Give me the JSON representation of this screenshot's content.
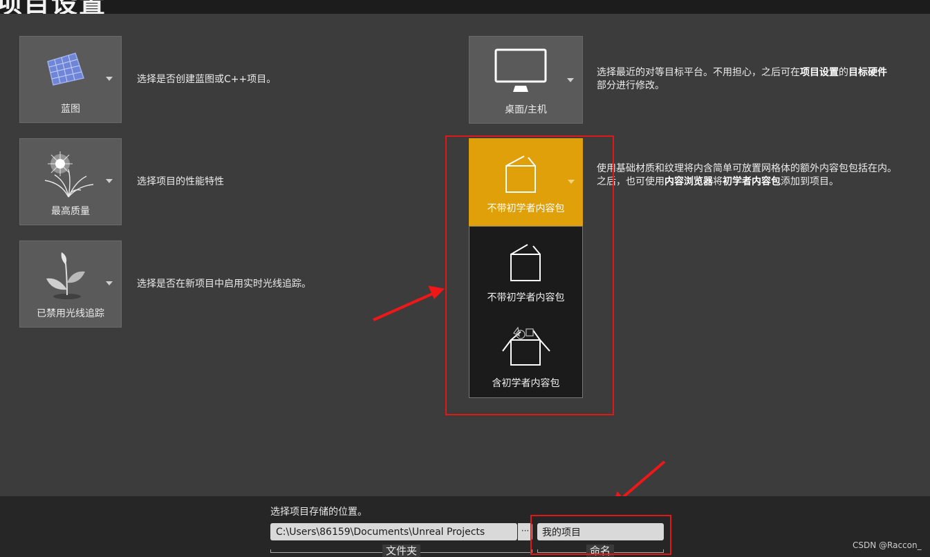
{
  "header": {
    "title": "项目设置"
  },
  "settings": [
    {
      "label": "蓝图",
      "icon": "blueprint-icon",
      "description": "选择是否创建蓝图或C++项目。"
    },
    {
      "label": "最高质量",
      "icon": "quality-icon",
      "description": "选择项目的性能特性"
    },
    {
      "label": "已禁用光线追踪",
      "icon": "plant-icon",
      "description": "选择是否在新项目中启用实时光线追踪。"
    }
  ],
  "platform": {
    "label": "桌面/主机",
    "icon": "monitor-icon",
    "description": {
      "part1": "选择最近的对等目标平台。不用担心，之后可在",
      "bold1": "项目设置",
      "part2": "的",
      "bold2": "目标硬件",
      "part3": "部分进行修改。"
    }
  },
  "starter_content": {
    "selected_label": "不带初学者内容包",
    "selected_color": "#dfa00a",
    "options": [
      {
        "label": "不带初学者内容包",
        "icon": "empty-box-icon"
      },
      {
        "label": "含初学者内容包",
        "icon": "starter-box-icon"
      }
    ],
    "description": {
      "line1": "使用基础材质和纹理将内含简单可放置网格体的额外内容包包括在内。",
      "line2_part1": "之后，也可使用",
      "line2_bold1": "内容浏览器",
      "line2_part2": "将",
      "line2_bold2": "初学者内容包",
      "line2_part3": "添加到项目。"
    }
  },
  "footer": {
    "hint": "选择项目存储的位置。",
    "path_value": "C:\\Users\\86159\\Documents\\Unreal Projects",
    "browse_label": "···",
    "name_value": "我的项目",
    "folder_label": "文件夹",
    "name_label": "命名"
  },
  "watermark": "CSDN @Raccon_",
  "annotation_color": "#e01818"
}
